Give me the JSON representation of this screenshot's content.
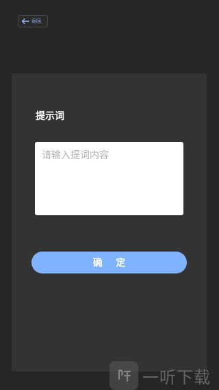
{
  "header": {
    "back_label": "返回"
  },
  "form": {
    "title": "提示词",
    "input_placeholder": "请输入提词内容",
    "input_value": "",
    "confirm_label": "确    定"
  },
  "watermark": {
    "text": "一听下载"
  }
}
